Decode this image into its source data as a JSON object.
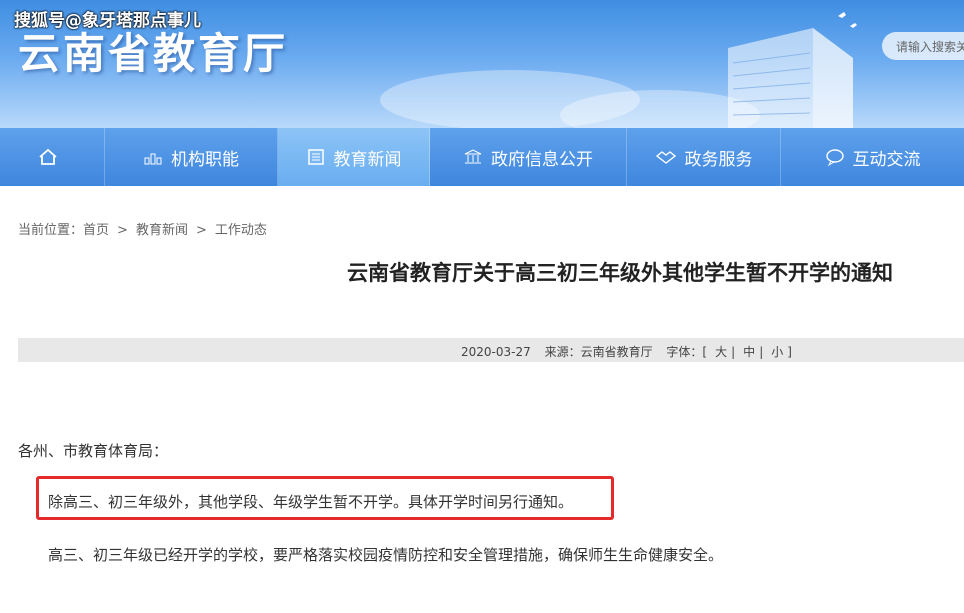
{
  "watermark": "搜狐号@象牙塔那点事儿",
  "site_title": "云南省教育厅",
  "search": {
    "placeholder": "请输入搜索关"
  },
  "nav": {
    "home_icon": "home-icon",
    "items": [
      {
        "label": "机构职能",
        "icon": "building-org-icon"
      },
      {
        "label": "教育新闻",
        "icon": "news-icon",
        "active": true
      },
      {
        "label": "政府信息公开",
        "icon": "government-icon"
      },
      {
        "label": "政务服务",
        "icon": "handshake-icon"
      },
      {
        "label": "互动交流",
        "icon": "chat-icon"
      }
    ]
  },
  "breadcrumb": {
    "prefix": "当前位置：",
    "items": [
      "首页",
      "教育新闻",
      "工作动态"
    ],
    "separator": ">"
  },
  "article": {
    "title": "云南省教育厅关于高三初三年级外其他学生暂不开学的通知",
    "date": "2020-03-27",
    "source": "来源：云南省教育厅",
    "font_label": "字体：[",
    "font_sizes": [
      "大",
      "中",
      "小"
    ],
    "font_divider": "|",
    "font_close": "]",
    "greeting": "各州、市教育体育局：",
    "paragraphs": [
      "除高三、初三年级外，其他学段、年级学生暂不开学。具体开学时间另行通知。",
      "高三、初三年级已经开学的学校，要严格落实校园疫情防控和安全管理措施，确保师生生命健康安全。"
    ]
  },
  "colors": {
    "nav_bg": "#4a90e2",
    "highlight_border": "#e42a2a",
    "meta_bg": "#e8e8e8"
  }
}
